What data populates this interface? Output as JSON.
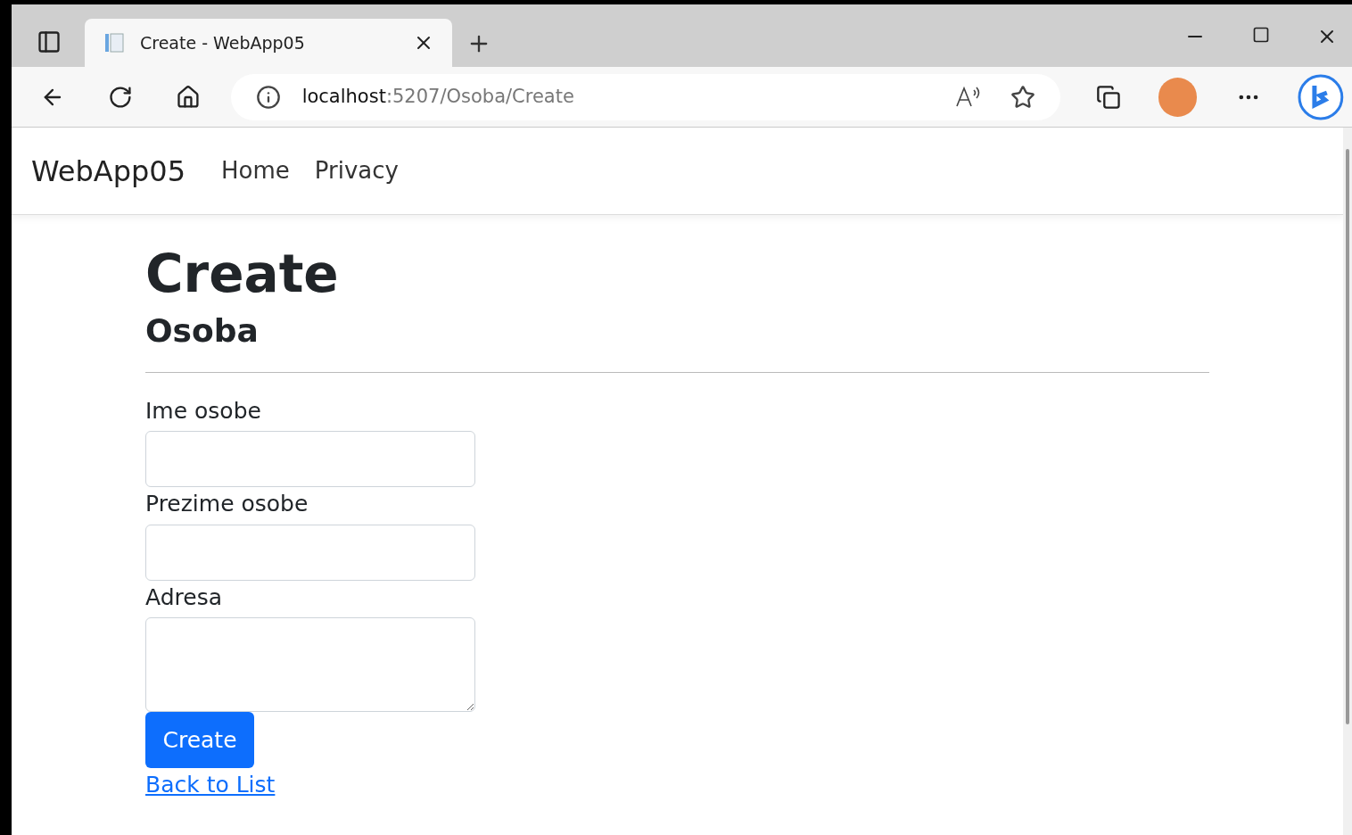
{
  "tabs": [
    {
      "title": "Create - WebApp05",
      "selected": true
    }
  ],
  "address_bar": {
    "host": "localhost",
    "path": ":5207/Osoba/Create"
  },
  "navbar": {
    "brand": "WebApp05",
    "links": [
      "Home",
      "Privacy"
    ]
  },
  "page": {
    "title": "Create",
    "subtitle": "Osoba",
    "fields": [
      {
        "label": "Ime osobe",
        "kind": "input"
      },
      {
        "label": "Prezime osobe",
        "kind": "input"
      },
      {
        "label": "Adresa",
        "kind": "textarea"
      }
    ],
    "submit": "Create",
    "back_link": "Back to List"
  }
}
